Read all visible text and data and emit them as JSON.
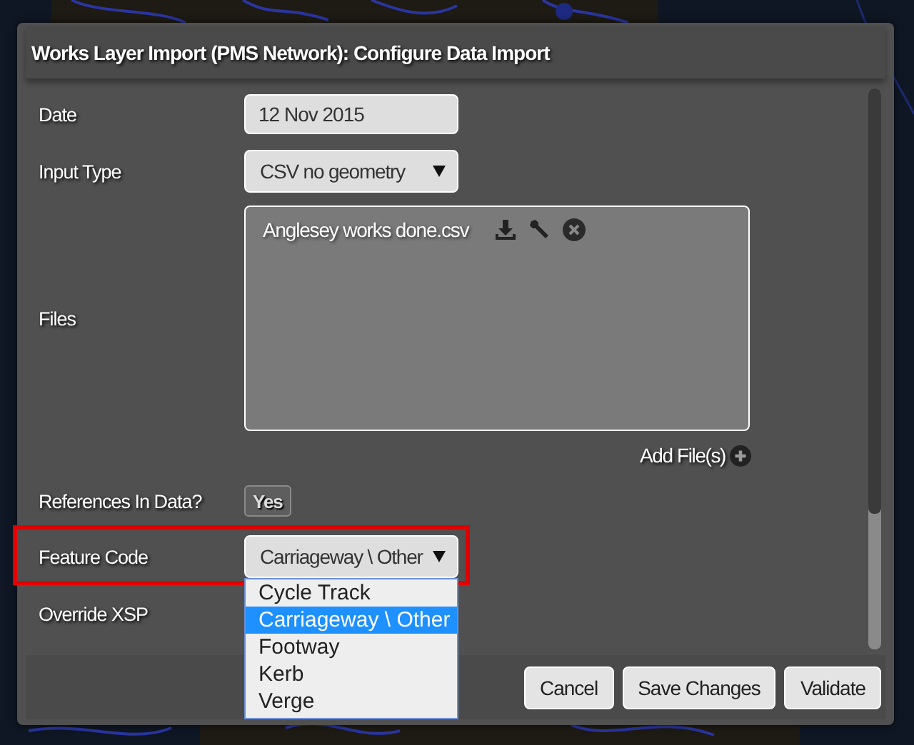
{
  "dialog": {
    "title": "Works Layer Import (PMS Network): Configure Data Import"
  },
  "fields": [
    {
      "label": "Date",
      "kind": "text",
      "value": "12 Nov 2015",
      "highlighted": false
    },
    {
      "label": "Input Type",
      "kind": "select",
      "value": "CSV no geometry",
      "highlighted": false
    },
    {
      "label": "Files",
      "kind": "files",
      "files": [
        {
          "name": "Anglesey works done.csv"
        }
      ],
      "add_label": "Add File(s)",
      "highlighted": false
    },
    {
      "label": "References In Data?",
      "kind": "toggle",
      "value": "Yes",
      "highlighted": false
    },
    {
      "label": "Feature Code",
      "kind": "select",
      "value": "Carriageway \\ Other",
      "highlighted": true
    },
    {
      "label": "Override XSP",
      "kind": "covered",
      "highlighted": false
    }
  ],
  "dropdown": {
    "options": [
      {
        "label": "Cycle Track",
        "selected": false
      },
      {
        "label": "Carriageway \\ Other",
        "selected": true
      },
      {
        "label": "Footway",
        "selected": false
      },
      {
        "label": "Kerb",
        "selected": false
      },
      {
        "label": "Verge",
        "selected": false
      }
    ]
  },
  "buttons": [
    "Cancel",
    "Save Changes",
    "Validate"
  ]
}
